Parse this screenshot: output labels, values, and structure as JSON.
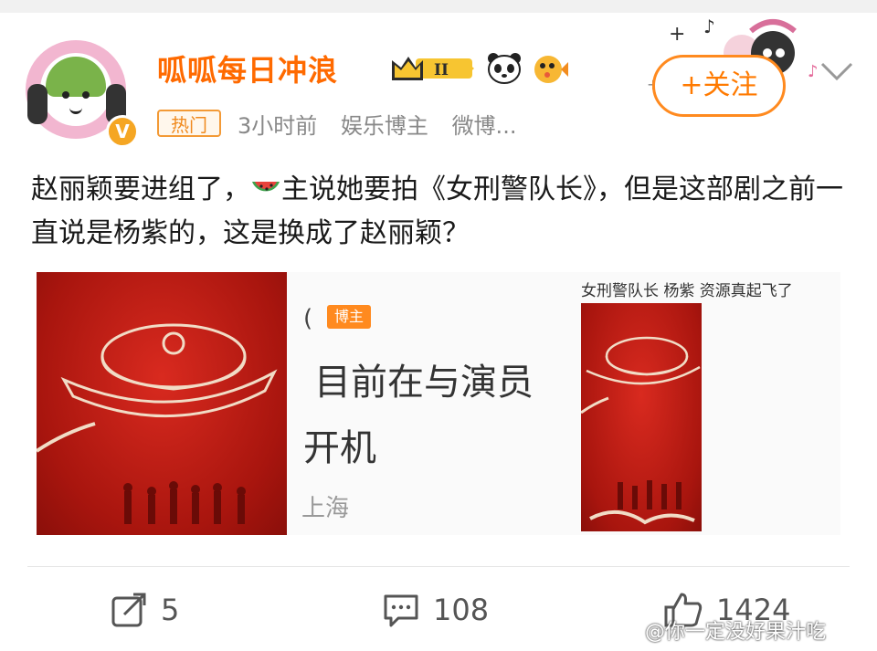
{
  "post": {
    "username": "呱呱每日冲浪",
    "level_badge": "II",
    "hot_tag": "热门",
    "time": "3小时前",
    "role": "娱乐博主",
    "source": "微博...",
    "follow_label": "+关注",
    "text_part1": "赵丽颖要进组了，",
    "text_part2": "主说她要拍《女刑警队长》，但是这部剧之前一直说是杨紫的，这是换成了赵丽颖？"
  },
  "images": {
    "img2_fragment": "(",
    "img2_badge": "博主",
    "img2_line1": "目前在与演员",
    "img2_line2": "开机",
    "img2_line3": "上海",
    "img3_caption": "女刑警队长 杨紫 资源真起飞了"
  },
  "actions": {
    "repost_count": "5",
    "comment_count": "108",
    "like_count": "1424"
  },
  "watermark": "@你一定没好果汁吃",
  "colors": {
    "brand_orange": "#ff6a00",
    "poster_red": "#c81e16"
  },
  "icons": [
    "repost-icon",
    "comment-icon",
    "like-icon",
    "watermelon-icon",
    "panda-icon",
    "pufferfish-icon",
    "crown-icon",
    "chevron-down-icon"
  ]
}
